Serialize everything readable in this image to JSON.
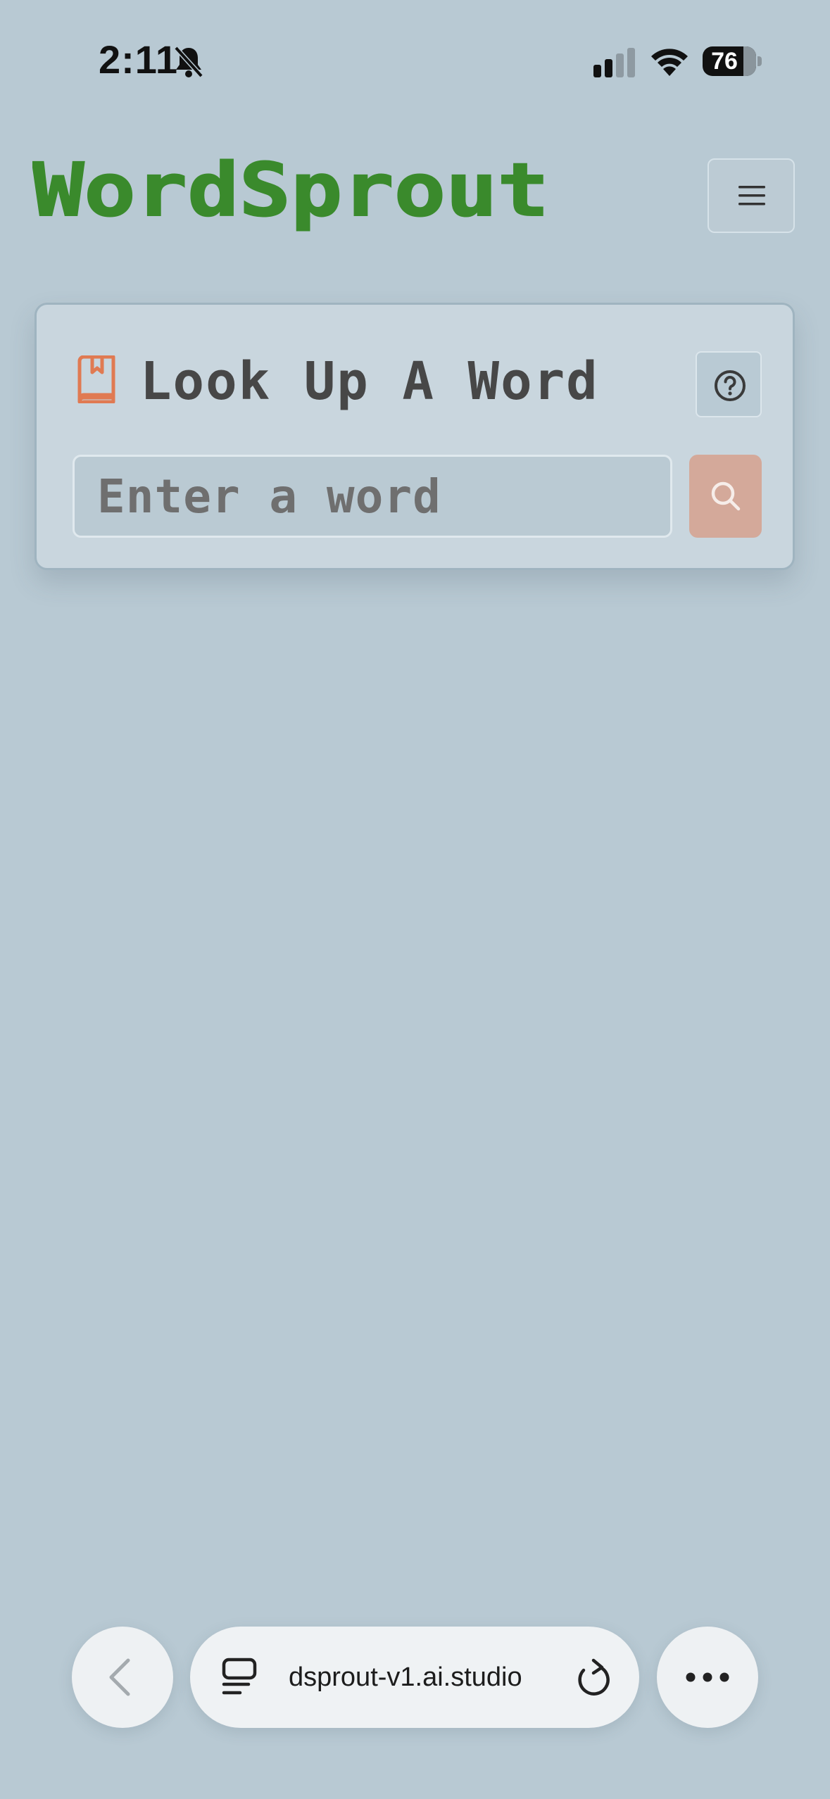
{
  "status_bar": {
    "time": "2:11",
    "battery": "76"
  },
  "header": {
    "app_name": "WordSprout"
  },
  "lookup": {
    "title": "Look Up A Word",
    "input_placeholder": "Enter a word",
    "input_value": ""
  },
  "browser": {
    "url": "dsprout-v1.ai.studio"
  },
  "colors": {
    "background": "#b8c9d3",
    "logo_green": "#3a8a2c",
    "accent_orange": "#e07a52",
    "search_button": "#d4a99a"
  },
  "icons": {
    "status": [
      "bell-slash-icon",
      "cellular-signal-icon",
      "wifi-icon",
      "battery-icon"
    ],
    "header": [
      "hamburger-menu-icon"
    ],
    "card": [
      "book-bookmark-icon",
      "question-circle-icon",
      "search-icon"
    ],
    "browser": [
      "chevron-left-icon",
      "tabs-icon",
      "reload-icon",
      "more-dots-icon"
    ]
  }
}
